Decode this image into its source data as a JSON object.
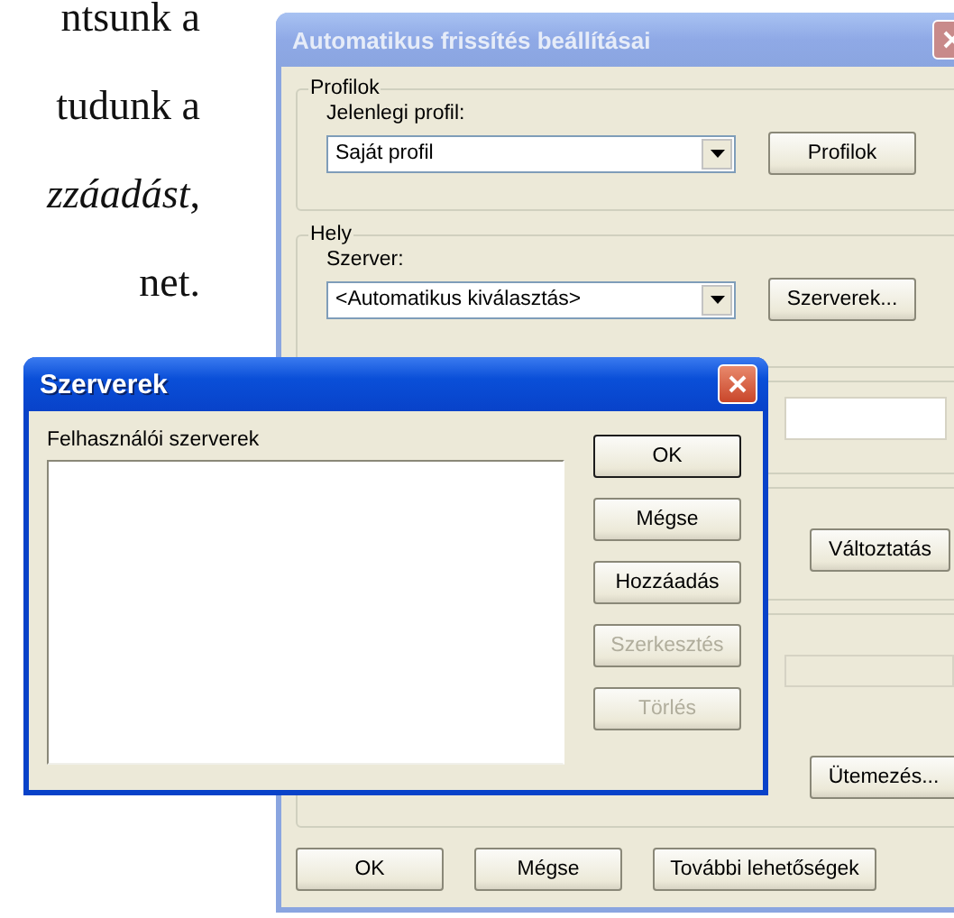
{
  "book_text": [
    "ntsunk a",
    "tudunk a",
    "*zzáadást*,",
    "net."
  ],
  "main_window": {
    "title": "Automatikus frissítés beállításai",
    "groups": [
      {
        "kind": "combo",
        "legend": "Profilok",
        "label": "Jelenlegi profil:",
        "value": "Saját profil",
        "button": "Profilok"
      },
      {
        "kind": "combo",
        "legend": "Hely",
        "label": "Szerver:",
        "value": "<Automatikus kiválasztás>",
        "button": "Szerverek..."
      },
      {
        "kind": "field"
      },
      {
        "kind": "button",
        "button": "Változtatás"
      },
      {
        "kind": "schedule",
        "button": "Ütemezés..."
      }
    ],
    "buttons": [
      "OK",
      "Mégse",
      "További lehetőségek"
    ]
  },
  "dialog": {
    "title": "Szerverek",
    "list_label": "Felhasználói szerverek",
    "buttons": [
      {
        "label": "OK",
        "default": true,
        "disabled": false
      },
      {
        "label": "Mégse",
        "default": false,
        "disabled": false
      },
      {
        "label": "Hozzáadás",
        "default": false,
        "disabled": false
      },
      {
        "label": "Szerkesztés",
        "default": false,
        "disabled": true
      },
      {
        "label": "Törlés",
        "default": false,
        "disabled": true
      }
    ]
  }
}
